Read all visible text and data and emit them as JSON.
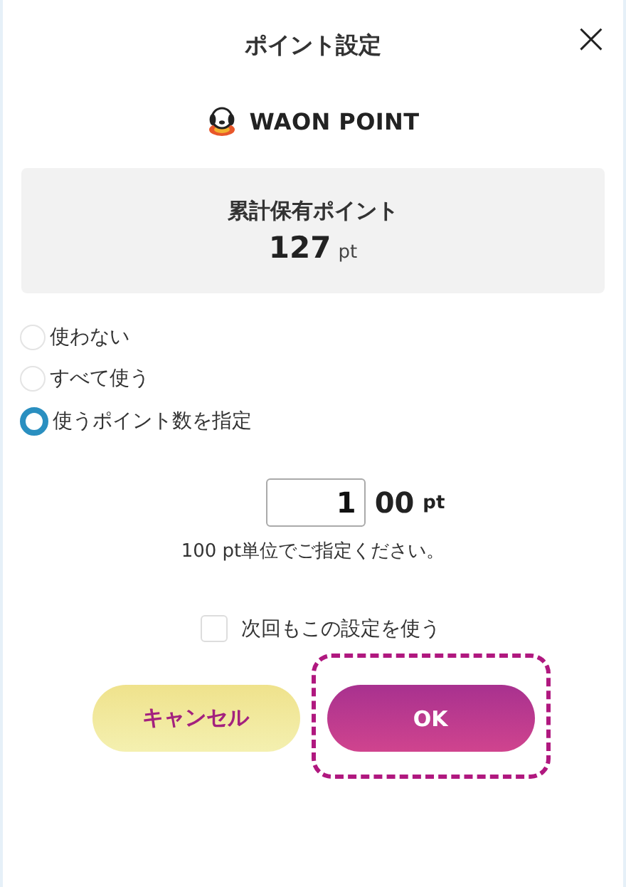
{
  "dialog": {
    "title": "ポイント設定",
    "close": "×"
  },
  "brand": {
    "name": "WAON POINT"
  },
  "balance": {
    "label": "累計保有ポイント",
    "value": "127",
    "unit": "pt"
  },
  "options": [
    {
      "label": "使わない",
      "selected": false
    },
    {
      "label": "すべて使う",
      "selected": false
    },
    {
      "label": "使うポイント数を指定",
      "selected": true
    }
  ],
  "amount": {
    "value": "1",
    "suffix": "00",
    "unit": "pt",
    "hint": "100 pt単位でご指定ください。"
  },
  "remember": {
    "label": "次回もこの設定を使う",
    "checked": false
  },
  "buttons": [
    {
      "label": "キャンセル",
      "kind": "cancel",
      "highlighted": false
    },
    {
      "label": "OK",
      "kind": "ok",
      "highlighted": true
    }
  ]
}
